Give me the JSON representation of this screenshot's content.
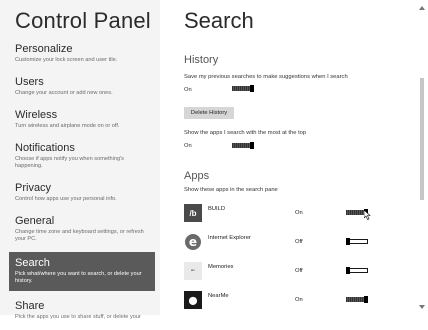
{
  "left": {
    "title": "Control Panel",
    "items": [
      {
        "title": "Personalize",
        "desc": "Customize your lock screen and user tile."
      },
      {
        "title": "Users",
        "desc": "Change your account or add new ones."
      },
      {
        "title": "Wireless",
        "desc": "Turn wireless and airplane mode on or off."
      },
      {
        "title": "Notifications",
        "desc": "Choose if apps notify you when something's happening."
      },
      {
        "title": "Privacy",
        "desc": "Control how apps use your personal info."
      },
      {
        "title": "General",
        "desc": "Change time zone and keyboard settings, or refresh your PC."
      },
      {
        "title": "Search",
        "desc": "Pick what/where you want to search, or delete your history."
      },
      {
        "title": "Share",
        "desc": "Pick the apps you use to share stuff, or delete your"
      }
    ]
  },
  "right": {
    "title": "Search",
    "history": {
      "heading": "History",
      "save_label": "Save my previous searches to make suggestions when I search",
      "save_state": "On",
      "delete_button": "Delete History",
      "top_label": "Show the apps I search with the most at the top",
      "top_state": "On"
    },
    "apps": {
      "heading": "Apps",
      "subtitle": "Show these apps in the search pane",
      "items": [
        {
          "name": "BUILD",
          "state": "On",
          "icon": "build-app-icon"
        },
        {
          "name": "Internet Explorer",
          "state": "Off",
          "icon": "internet-explorer-icon"
        },
        {
          "name": "Memories",
          "state": "Off",
          "icon": "memories-app-icon"
        },
        {
          "name": "NearMe",
          "state": "On",
          "icon": "nearme-app-icon"
        }
      ]
    }
  },
  "colors": {
    "active_bg": "#5a5a5a",
    "left_bg": "#f4f4f4",
    "toggle_dark": "#1a1a1a",
    "button_bg": "#d6d6d6"
  }
}
